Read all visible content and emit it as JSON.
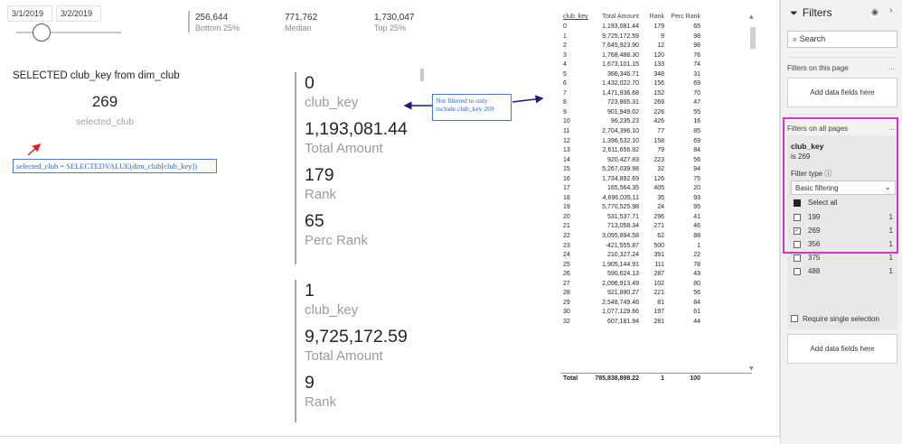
{
  "slicer": {
    "start_date": "3/1/2019",
    "end_date": "3/2/2019"
  },
  "kpis": [
    {
      "value": "256,644",
      "label": "Bottom 25%"
    },
    {
      "value": "771,762",
      "label": "Median"
    },
    {
      "value": "1,730,047",
      "label": "Top 25%"
    }
  ],
  "selected": {
    "title": "SELECTED club_key from dim_club",
    "value": "269",
    "label": "selected_club"
  },
  "formula_note": "selected_club = SELECTEDVALUE(dim_club[club_key])",
  "filter_note": "Not filtered to only include club_key 269",
  "cards": [
    {
      "club_key": "0",
      "club_key_label": "club_key",
      "amount": "1,193,081.44",
      "amount_label": "Total Amount",
      "rank": "179",
      "rank_label": "Rank",
      "perc": "65",
      "perc_label": "Perc Rank"
    },
    {
      "club_key": "1",
      "club_key_label": "club_key",
      "amount": "9,725,172.59",
      "amount_label": "Total Amount",
      "rank": "9",
      "rank_label": "Rank"
    }
  ],
  "table": {
    "headers": [
      "club_key",
      "Total Amount",
      "Rank",
      "Perc Rank"
    ],
    "rows": [
      [
        "0",
        "1,193,081.44",
        "179",
        "65"
      ],
      [
        "1",
        "9,725,172.59",
        "9",
        "98"
      ],
      [
        "2",
        "7,645,923.90",
        "12",
        "98"
      ],
      [
        "3",
        "1,768,488.30",
        "120",
        "76"
      ],
      [
        "4",
        "1,673,101.15",
        "133",
        "74"
      ],
      [
        "5",
        "366,346.71",
        "348",
        "31"
      ],
      [
        "6",
        "1,432,022.70",
        "156",
        "69"
      ],
      [
        "7",
        "1,471,936.68",
        "152",
        "70"
      ],
      [
        "8",
        "723,865.31",
        "269",
        "47"
      ],
      [
        "9",
        "901,949.02",
        "226",
        "55"
      ],
      [
        "10",
        "96,235.23",
        "426",
        "16"
      ],
      [
        "11",
        "2,704,396.10",
        "77",
        "85"
      ],
      [
        "12",
        "1,396,532.10",
        "158",
        "69"
      ],
      [
        "13",
        "2,611,656.92",
        "79",
        "84"
      ],
      [
        "14",
        "920,427.83",
        "223",
        "56"
      ],
      [
        "15",
        "5,267,039.98",
        "32",
        "94"
      ],
      [
        "16",
        "1,734,892.69",
        "126",
        "75"
      ],
      [
        "17",
        "165,564.35",
        "405",
        "20"
      ],
      [
        "18",
        "4,696,035.11",
        "35",
        "93"
      ],
      [
        "19",
        "5,770,525.98",
        "24",
        "95"
      ],
      [
        "20",
        "531,537.71",
        "296",
        "41"
      ],
      [
        "21",
        "713,058.34",
        "271",
        "46"
      ],
      [
        "22",
        "3,095,894.58",
        "62",
        "88"
      ],
      [
        "23",
        "-421,555.87",
        "500",
        "1"
      ],
      [
        "24",
        "210,327.24",
        "391",
        "22"
      ],
      [
        "25",
        "1,905,144.91",
        "111",
        "78"
      ],
      [
        "26",
        "590,624.13",
        "287",
        "43"
      ],
      [
        "27",
        "2,096,913.49",
        "102",
        "80"
      ],
      [
        "28",
        "921,890.27",
        "221",
        "56"
      ],
      [
        "29",
        "2,548,749.46",
        "81",
        "84"
      ],
      [
        "30",
        "1,077,129.66",
        "197",
        "61"
      ],
      [
        "32",
        "607,181.94",
        "281",
        "44"
      ]
    ],
    "total": [
      "Total",
      "785,838,898.22",
      "1",
      "100"
    ]
  },
  "filters": {
    "title": "Filters",
    "search_placeholder": "Search",
    "on_this_page": "Filters on this page",
    "add_fields": "Add data fields here",
    "on_all_pages": "Filters on all pages",
    "field": "club_key",
    "condition": "is 269",
    "filter_type_label": "Filter type",
    "filter_type": "Basic filtering",
    "select_all": "Select all",
    "items": [
      {
        "value": "199",
        "count": "1",
        "checked": false
      },
      {
        "value": "269",
        "count": "1",
        "checked": true
      },
      {
        "value": "356",
        "count": "1",
        "checked": false
      },
      {
        "value": "375",
        "count": "1",
        "checked": false
      },
      {
        "value": "488",
        "count": "1",
        "checked": false
      }
    ],
    "require_single": "Require single selection",
    "dots": "..."
  },
  "colors": {
    "highlight": "#cc39cc",
    "annotation": "#2b5fc1",
    "arrow_red": "#e02020",
    "arrow_navy": "#1a1a7a"
  }
}
